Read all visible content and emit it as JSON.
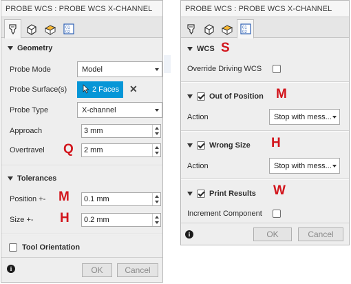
{
  "left": {
    "title": "PROBE WCS : PROBE WCS X-CHANNEL",
    "tabs": [
      {
        "icon": "probe-tool-icon",
        "active": true
      },
      {
        "icon": "cube-setup-icon",
        "active": false
      },
      {
        "icon": "stock-cube-icon",
        "active": false
      },
      {
        "icon": "program-icon",
        "active": false
      }
    ],
    "geometry": {
      "header": "Geometry",
      "probe_mode": {
        "label": "Probe Mode",
        "value": "Model"
      },
      "probe_surfaces": {
        "label": "Probe Surface(s)",
        "button": "2 Faces"
      },
      "probe_type": {
        "label": "Probe Type",
        "value": "X-channel"
      },
      "approach": {
        "label": "Approach",
        "value": "3 mm"
      },
      "overtravel": {
        "label": "Overtravel",
        "value": "2 mm"
      }
    },
    "tolerances": {
      "header": "Tolerances",
      "position": {
        "label": "Position +-",
        "value": "0.1 mm"
      },
      "size": {
        "label": "Size +-",
        "value": "0.2 mm"
      }
    },
    "tool_orientation": {
      "label": "Tool Orientation",
      "checked": false
    },
    "callouts": {
      "overtravel": "Q",
      "position": "M",
      "size": "H"
    },
    "footer": {
      "ok": "OK",
      "cancel": "Cancel",
      "info": "i"
    }
  },
  "right": {
    "title": "PROBE WCS : PROBE WCS X-CHANNEL",
    "tabs": [
      {
        "icon": "probe-tool-icon",
        "active": false
      },
      {
        "icon": "cube-setup-icon",
        "active": false
      },
      {
        "icon": "stock-cube-icon",
        "active": false
      },
      {
        "icon": "program-icon",
        "active": true
      }
    ],
    "wcs": {
      "header": "WCS",
      "override": {
        "label": "Override Driving WCS",
        "checked": false
      }
    },
    "out_of_position": {
      "header": "Out of Position",
      "checked": true,
      "action_label": "Action",
      "action_value": "Stop with mess..."
    },
    "wrong_size": {
      "header": "Wrong Size",
      "checked": true,
      "action_label": "Action",
      "action_value": "Stop with mess..."
    },
    "print_results": {
      "header": "Print Results",
      "checked": true,
      "increment": {
        "label": "Increment Component",
        "checked": false
      }
    },
    "callouts": {
      "wcs": "S",
      "out_of_position": "M",
      "wrong_size": "H",
      "print_results": "W"
    },
    "footer": {
      "ok": "OK",
      "cancel": "Cancel",
      "info": "i"
    }
  }
}
